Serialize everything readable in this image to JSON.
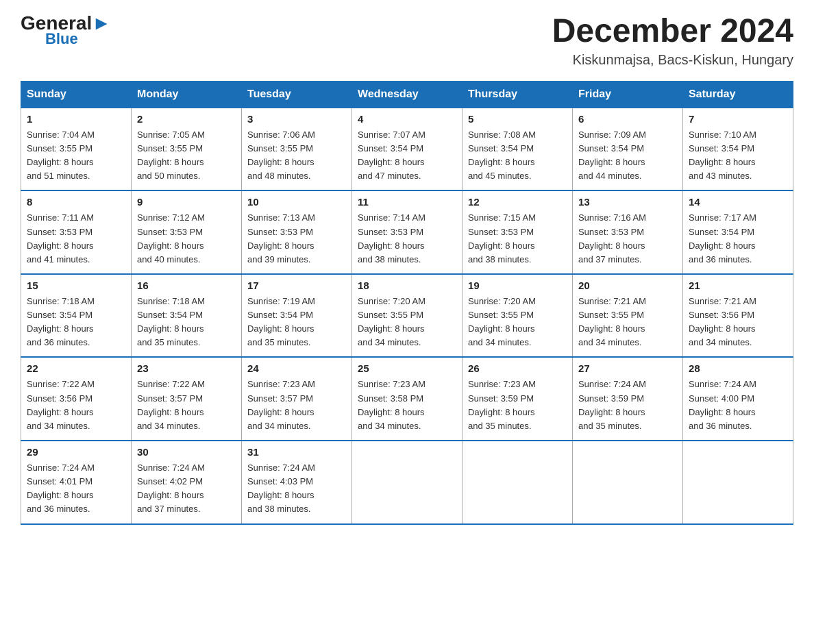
{
  "header": {
    "logo_general": "General",
    "logo_triangle": "▲",
    "logo_blue": "Blue",
    "month_year": "December 2024",
    "location": "Kiskunmajsa, Bacs-Kiskun, Hungary"
  },
  "days_of_week": [
    "Sunday",
    "Monday",
    "Tuesday",
    "Wednesday",
    "Thursday",
    "Friday",
    "Saturday"
  ],
  "weeks": [
    [
      {
        "day": "1",
        "sunrise": "7:04 AM",
        "sunset": "3:55 PM",
        "daylight": "8 hours and 51 minutes."
      },
      {
        "day": "2",
        "sunrise": "7:05 AM",
        "sunset": "3:55 PM",
        "daylight": "8 hours and 50 minutes."
      },
      {
        "day": "3",
        "sunrise": "7:06 AM",
        "sunset": "3:55 PM",
        "daylight": "8 hours and 48 minutes."
      },
      {
        "day": "4",
        "sunrise": "7:07 AM",
        "sunset": "3:54 PM",
        "daylight": "8 hours and 47 minutes."
      },
      {
        "day": "5",
        "sunrise": "7:08 AM",
        "sunset": "3:54 PM",
        "daylight": "8 hours and 45 minutes."
      },
      {
        "day": "6",
        "sunrise": "7:09 AM",
        "sunset": "3:54 PM",
        "daylight": "8 hours and 44 minutes."
      },
      {
        "day": "7",
        "sunrise": "7:10 AM",
        "sunset": "3:54 PM",
        "daylight": "8 hours and 43 minutes."
      }
    ],
    [
      {
        "day": "8",
        "sunrise": "7:11 AM",
        "sunset": "3:53 PM",
        "daylight": "8 hours and 41 minutes."
      },
      {
        "day": "9",
        "sunrise": "7:12 AM",
        "sunset": "3:53 PM",
        "daylight": "8 hours and 40 minutes."
      },
      {
        "day": "10",
        "sunrise": "7:13 AM",
        "sunset": "3:53 PM",
        "daylight": "8 hours and 39 minutes."
      },
      {
        "day": "11",
        "sunrise": "7:14 AM",
        "sunset": "3:53 PM",
        "daylight": "8 hours and 38 minutes."
      },
      {
        "day": "12",
        "sunrise": "7:15 AM",
        "sunset": "3:53 PM",
        "daylight": "8 hours and 38 minutes."
      },
      {
        "day": "13",
        "sunrise": "7:16 AM",
        "sunset": "3:53 PM",
        "daylight": "8 hours and 37 minutes."
      },
      {
        "day": "14",
        "sunrise": "7:17 AM",
        "sunset": "3:54 PM",
        "daylight": "8 hours and 36 minutes."
      }
    ],
    [
      {
        "day": "15",
        "sunrise": "7:18 AM",
        "sunset": "3:54 PM",
        "daylight": "8 hours and 36 minutes."
      },
      {
        "day": "16",
        "sunrise": "7:18 AM",
        "sunset": "3:54 PM",
        "daylight": "8 hours and 35 minutes."
      },
      {
        "day": "17",
        "sunrise": "7:19 AM",
        "sunset": "3:54 PM",
        "daylight": "8 hours and 35 minutes."
      },
      {
        "day": "18",
        "sunrise": "7:20 AM",
        "sunset": "3:55 PM",
        "daylight": "8 hours and 34 minutes."
      },
      {
        "day": "19",
        "sunrise": "7:20 AM",
        "sunset": "3:55 PM",
        "daylight": "8 hours and 34 minutes."
      },
      {
        "day": "20",
        "sunrise": "7:21 AM",
        "sunset": "3:55 PM",
        "daylight": "8 hours and 34 minutes."
      },
      {
        "day": "21",
        "sunrise": "7:21 AM",
        "sunset": "3:56 PM",
        "daylight": "8 hours and 34 minutes."
      }
    ],
    [
      {
        "day": "22",
        "sunrise": "7:22 AM",
        "sunset": "3:56 PM",
        "daylight": "8 hours and 34 minutes."
      },
      {
        "day": "23",
        "sunrise": "7:22 AM",
        "sunset": "3:57 PM",
        "daylight": "8 hours and 34 minutes."
      },
      {
        "day": "24",
        "sunrise": "7:23 AM",
        "sunset": "3:57 PM",
        "daylight": "8 hours and 34 minutes."
      },
      {
        "day": "25",
        "sunrise": "7:23 AM",
        "sunset": "3:58 PM",
        "daylight": "8 hours and 34 minutes."
      },
      {
        "day": "26",
        "sunrise": "7:23 AM",
        "sunset": "3:59 PM",
        "daylight": "8 hours and 35 minutes."
      },
      {
        "day": "27",
        "sunrise": "7:24 AM",
        "sunset": "3:59 PM",
        "daylight": "8 hours and 35 minutes."
      },
      {
        "day": "28",
        "sunrise": "7:24 AM",
        "sunset": "4:00 PM",
        "daylight": "8 hours and 36 minutes."
      }
    ],
    [
      {
        "day": "29",
        "sunrise": "7:24 AM",
        "sunset": "4:01 PM",
        "daylight": "8 hours and 36 minutes."
      },
      {
        "day": "30",
        "sunrise": "7:24 AM",
        "sunset": "4:02 PM",
        "daylight": "8 hours and 37 minutes."
      },
      {
        "day": "31",
        "sunrise": "7:24 AM",
        "sunset": "4:03 PM",
        "daylight": "8 hours and 38 minutes."
      },
      null,
      null,
      null,
      null
    ]
  ],
  "labels": {
    "sunrise": "Sunrise:",
    "sunset": "Sunset:",
    "daylight": "Daylight:"
  }
}
